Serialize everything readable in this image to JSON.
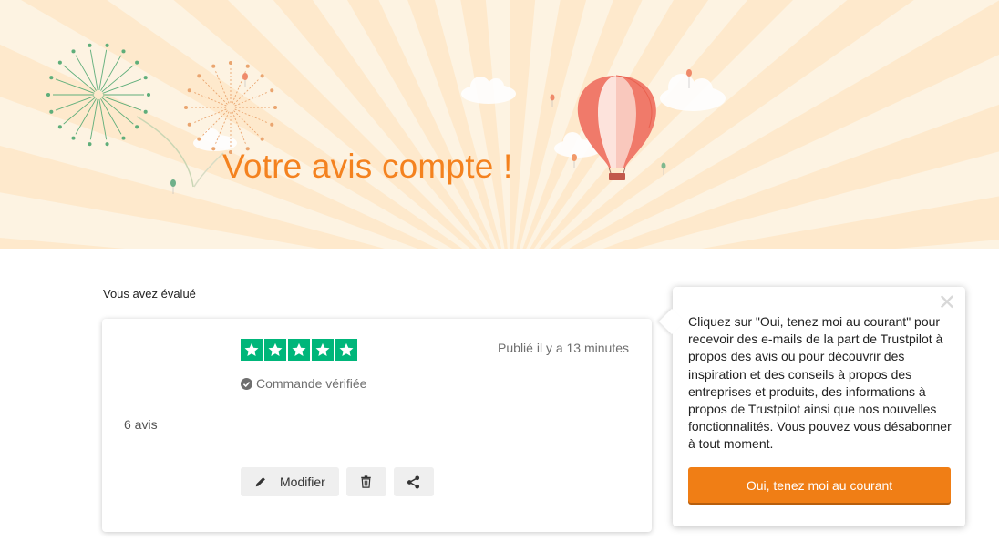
{
  "hero": {
    "title": "Votre avis compte !"
  },
  "review": {
    "section_label": "Vous avez évalué",
    "rating": 5,
    "max_rating": 5,
    "published": "Publié il y a 13 minutes",
    "verified": "Commande vérifiée",
    "review_count": "6 avis",
    "actions": {
      "edit_label": "Modifier"
    }
  },
  "popover": {
    "close_symbol": "✕",
    "text": "Cliquez sur \"Oui, tenez moi au courant\" pour recevoir des e-mails de la part de Trustpilot à propos des avis ou pour découvrir des inspiration et des conseils à propos des entreprises et produits, des informations à propos de Trustpilot ainsi que nos nouvelles fonctionnalités. Vous pouvez vous désabonner à tout moment.",
    "cta_label": "Oui, tenez moi au courant"
  },
  "colors": {
    "accent": "#f4821f",
    "star_green": "#00b67a",
    "cta": "#f07e15",
    "hero_bg": "#fdf3e2"
  },
  "icons": [
    "star-icon",
    "check-circle-icon",
    "pencil-icon",
    "trash-icon",
    "share-icon",
    "close-icon",
    "hot-air-balloon-icon",
    "firework-icon",
    "cloud-icon"
  ]
}
